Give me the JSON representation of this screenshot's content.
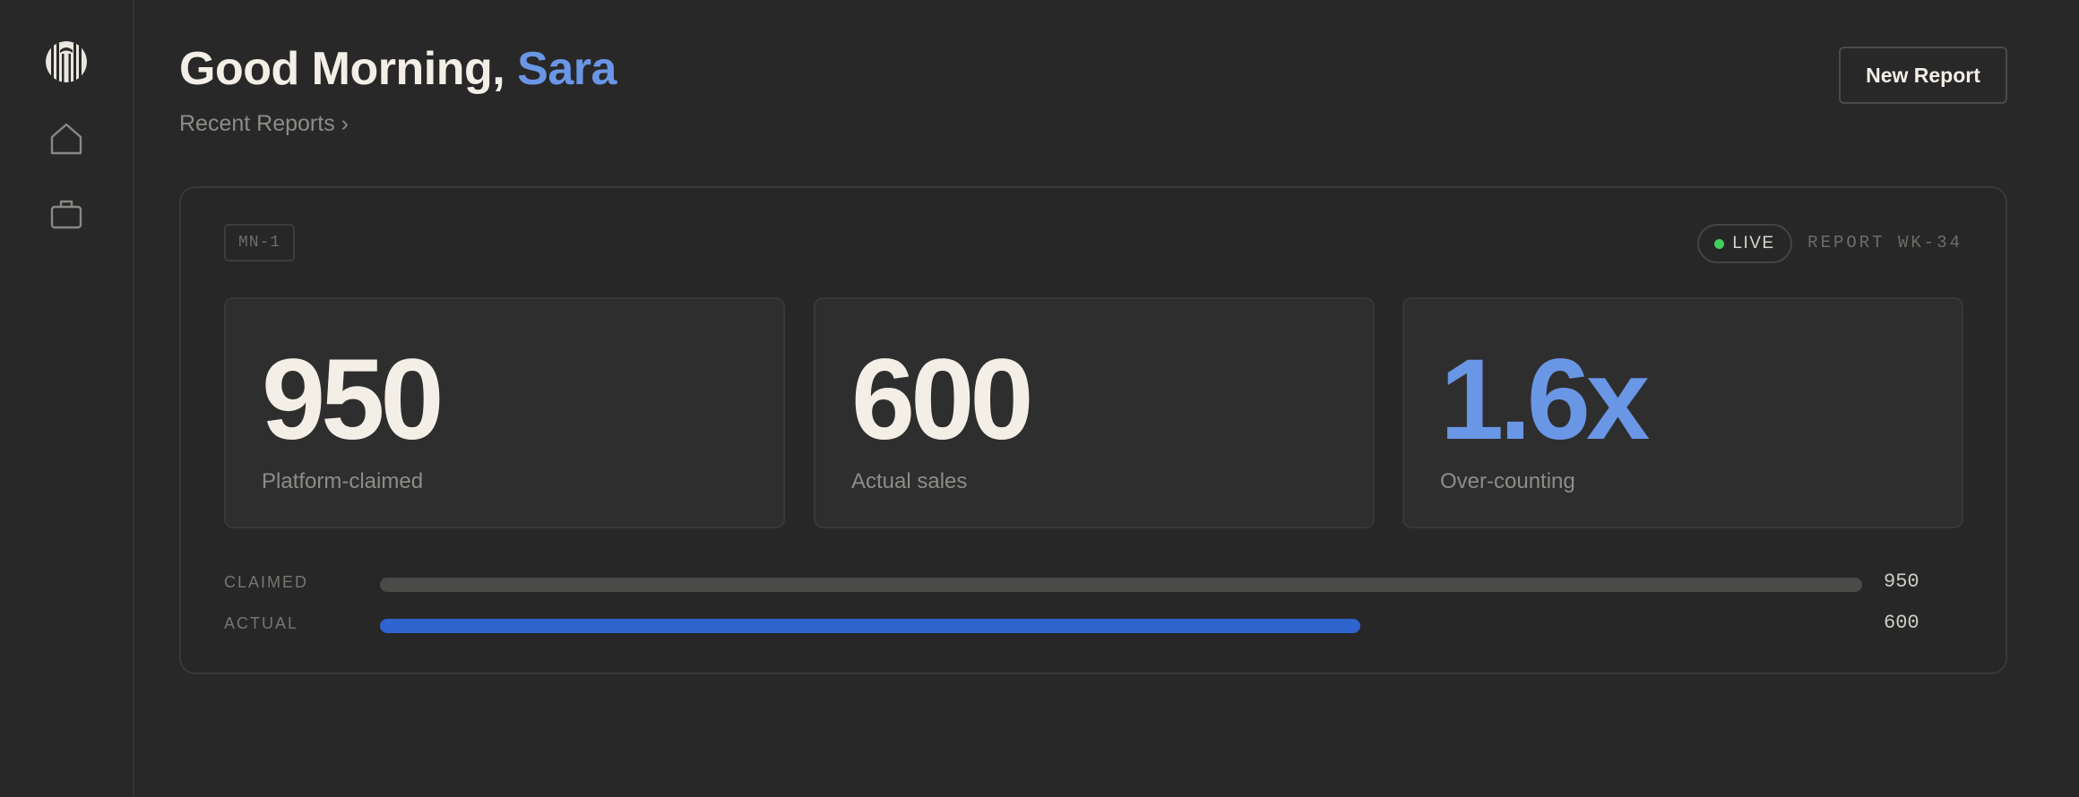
{
  "sidebar": {
    "icons": [
      "logo",
      "home-icon",
      "briefcase-icon"
    ]
  },
  "header": {
    "greeting_prefix": "Good Morning, ",
    "user_name": "Sara",
    "recent_reports_link": "Recent Reports ›",
    "new_report_label": "New Report"
  },
  "report": {
    "tag": "MN-1",
    "status": "LIVE",
    "report_id": "REPORT WK-34",
    "stats": [
      {
        "value": "950",
        "label": "Platform-claimed"
      },
      {
        "value": "600",
        "label": "Actual sales"
      },
      {
        "value": "1.6x",
        "label": "Over-counting"
      }
    ],
    "bars": [
      {
        "label": "CLAIMED",
        "value": 950,
        "value_text": "950"
      },
      {
        "label": "ACTUAL",
        "value": 600,
        "value_text": "600"
      }
    ],
    "bar_max": 950
  },
  "colors": {
    "accent": "#6a96e6",
    "actual_bar": "#2f63cd",
    "claimed_bar": "#4a4a48",
    "live_dot": "#3fcf5e",
    "background": "#282828"
  }
}
